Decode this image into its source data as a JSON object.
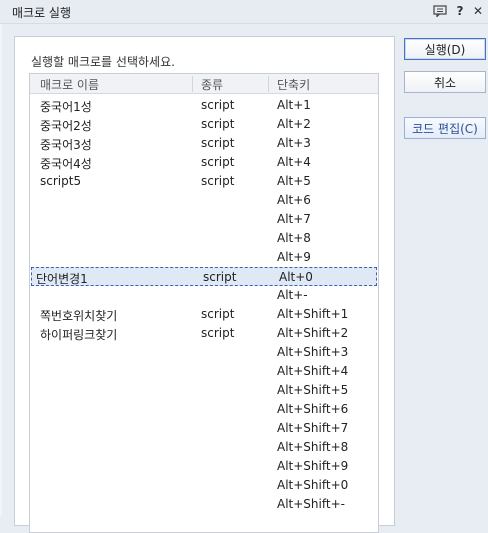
{
  "window": {
    "title": "매크로 실행"
  },
  "instruction": "실행할 매크로를 선택하세요.",
  "columns": {
    "name": "매크로 이름",
    "type": "종류",
    "shortcut": "단축키"
  },
  "rows": [
    {
      "name": "중국어1성",
      "type": "script",
      "shortcut": "Alt+1"
    },
    {
      "name": "중국어2성",
      "type": "script",
      "shortcut": "Alt+2"
    },
    {
      "name": "중국어3성",
      "type": "script",
      "shortcut": "Alt+3"
    },
    {
      "name": "중국어4성",
      "type": "script",
      "shortcut": "Alt+4"
    },
    {
      "name": "script5",
      "type": "script",
      "shortcut": "Alt+5"
    },
    {
      "name": "",
      "type": "",
      "shortcut": "Alt+6"
    },
    {
      "name": "",
      "type": "",
      "shortcut": "Alt+7"
    },
    {
      "name": "",
      "type": "",
      "shortcut": "Alt+8"
    },
    {
      "name": "",
      "type": "",
      "shortcut": "Alt+9"
    },
    {
      "name": "단어변경1",
      "type": "script",
      "shortcut": "Alt+0",
      "selected": true
    },
    {
      "name": "",
      "type": "",
      "shortcut": "Alt+-"
    },
    {
      "name": "쪽번호위치찾기",
      "type": "script",
      "shortcut": "Alt+Shift+1"
    },
    {
      "name": "하이퍼링크찾기",
      "type": "script",
      "shortcut": "Alt+Shift+2"
    },
    {
      "name": "",
      "type": "",
      "shortcut": "Alt+Shift+3"
    },
    {
      "name": "",
      "type": "",
      "shortcut": "Alt+Shift+4"
    },
    {
      "name": "",
      "type": "",
      "shortcut": "Alt+Shift+5"
    },
    {
      "name": "",
      "type": "",
      "shortcut": "Alt+Shift+6"
    },
    {
      "name": "",
      "type": "",
      "shortcut": "Alt+Shift+7"
    },
    {
      "name": "",
      "type": "",
      "shortcut": "Alt+Shift+8"
    },
    {
      "name": "",
      "type": "",
      "shortcut": "Alt+Shift+9"
    },
    {
      "name": "",
      "type": "",
      "shortcut": "Alt+Shift+0"
    },
    {
      "name": "",
      "type": "",
      "shortcut": "Alt+Shift+-"
    }
  ],
  "buttons": {
    "run": "실행(D)",
    "cancel": "취소",
    "code_edit": "코드 편집(C)"
  },
  "icons": {
    "speech": "speech-bubble-icon",
    "help": "help-icon",
    "close": "close-icon"
  }
}
